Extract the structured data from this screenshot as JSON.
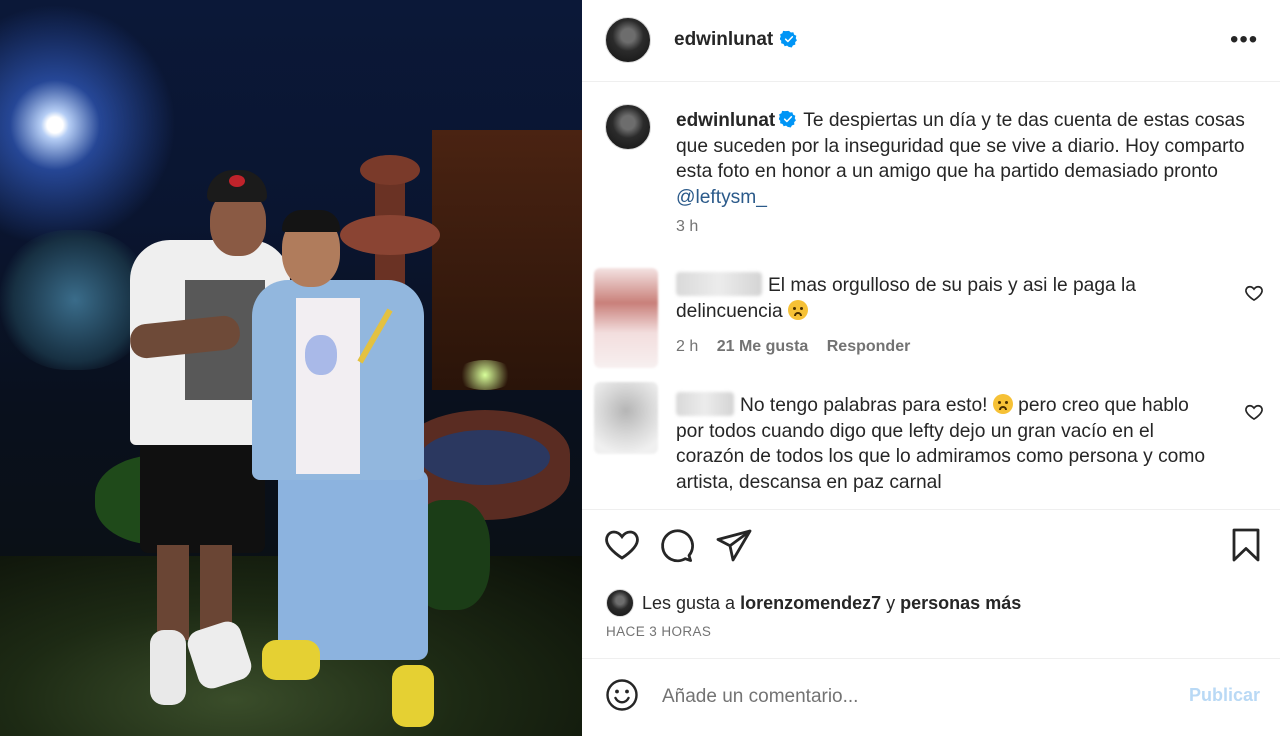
{
  "post": {
    "author": "edwinlunat",
    "verified": true,
    "more_icon": "more-horizontal-icon",
    "caption": "Te despiertas un día y te das cuenta de estas cosas que suceden por la inseguridad que se vive a diario. Hoy comparto esta foto en honor a un amigo que ha partido demasiado pronto",
    "caption_mention": "@leftysm_",
    "caption_time": "3 h"
  },
  "comments": [
    {
      "text": "El mas orgulloso de su pais y asi le paga la delincuencia",
      "emoji": "sad-face-emoji",
      "time": "2 h",
      "likes": "21 Me gusta",
      "reply": "Responder"
    },
    {
      "text_before": "No tengo palabras para esto!",
      "emoji": "disappointed-face-emoji",
      "text_after": "pero creo que hablo por todos cuando digo que lefty dejo un gran vacío en el corazón de todos los que lo admiramos como persona y como artista, descansa en paz carnal"
    }
  ],
  "actions": {
    "like_icon": "heart-icon",
    "comment_icon": "comment-icon",
    "share_icon": "share-icon",
    "save_icon": "bookmark-icon"
  },
  "likes": {
    "prefix": "Les gusta a",
    "user": "lorenzomendez7",
    "connector": "y",
    "suffix": "personas más"
  },
  "timestamp": "HACE 3 HORAS",
  "add_comment": {
    "placeholder": "Añade un comentario...",
    "publish": "Publicar"
  },
  "colors": {
    "verified_blue": "#0095f6",
    "mention": "#2b5a8a",
    "publish_disabled": "#b9d9f5",
    "secondary_text": "#737373"
  }
}
